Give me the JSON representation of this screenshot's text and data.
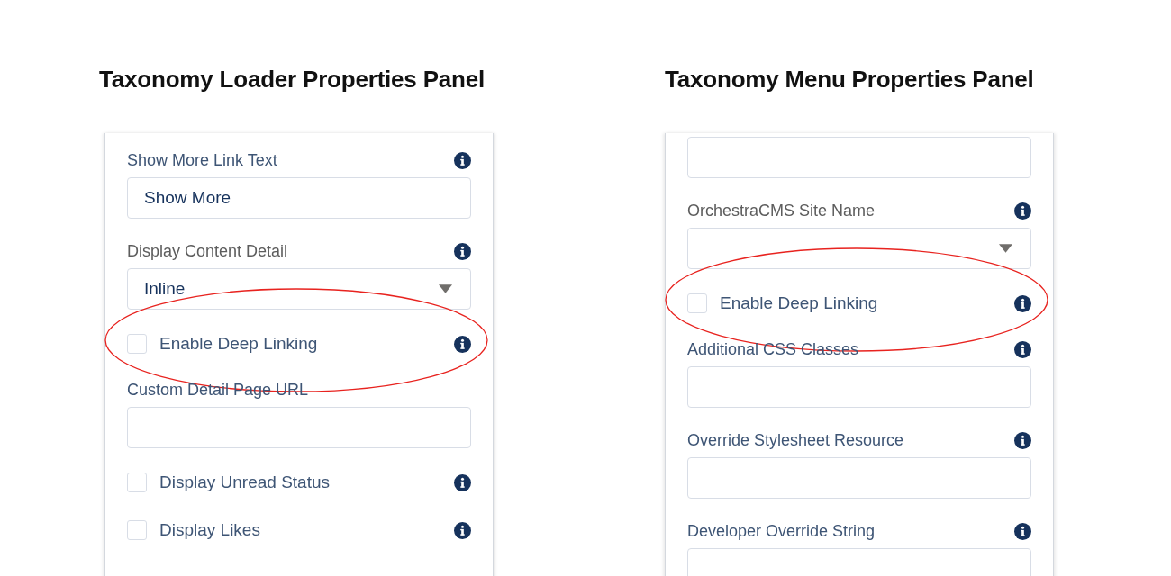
{
  "panels": [
    {
      "title": "Taxonomy Loader Properties Panel",
      "fields": [
        {
          "kind": "text",
          "label": "Show More Link Text",
          "value": "Show More",
          "info": true
        },
        {
          "kind": "select",
          "label": "Display Content Detail",
          "value": "Inline",
          "info": true
        },
        {
          "kind": "checkbox",
          "label": "Enable Deep Linking",
          "checked": false,
          "info": true,
          "highlighted": true
        },
        {
          "kind": "text",
          "label": "Custom Detail Page URL"
        },
        {
          "kind": "checkbox",
          "label": "Display Unread Status",
          "checked": false,
          "info": true
        },
        {
          "kind": "checkbox",
          "label": "Display Likes",
          "checked": false,
          "info": true
        }
      ]
    },
    {
      "title": "Taxonomy Menu Properties Panel",
      "fields": [
        {
          "kind": "text"
        },
        {
          "kind": "select",
          "label": "OrchestraCMS Site Name",
          "info": true
        },
        {
          "kind": "checkbox",
          "label": "Enable Deep Linking",
          "checked": false,
          "info": true,
          "highlighted": true
        },
        {
          "kind": "text",
          "label": "Additional CSS Classes",
          "info": true
        },
        {
          "kind": "text",
          "label": "Override Stylesheet Resource",
          "info": true
        },
        {
          "kind": "text",
          "label": "Developer Override String",
          "info": true
        }
      ]
    }
  ]
}
